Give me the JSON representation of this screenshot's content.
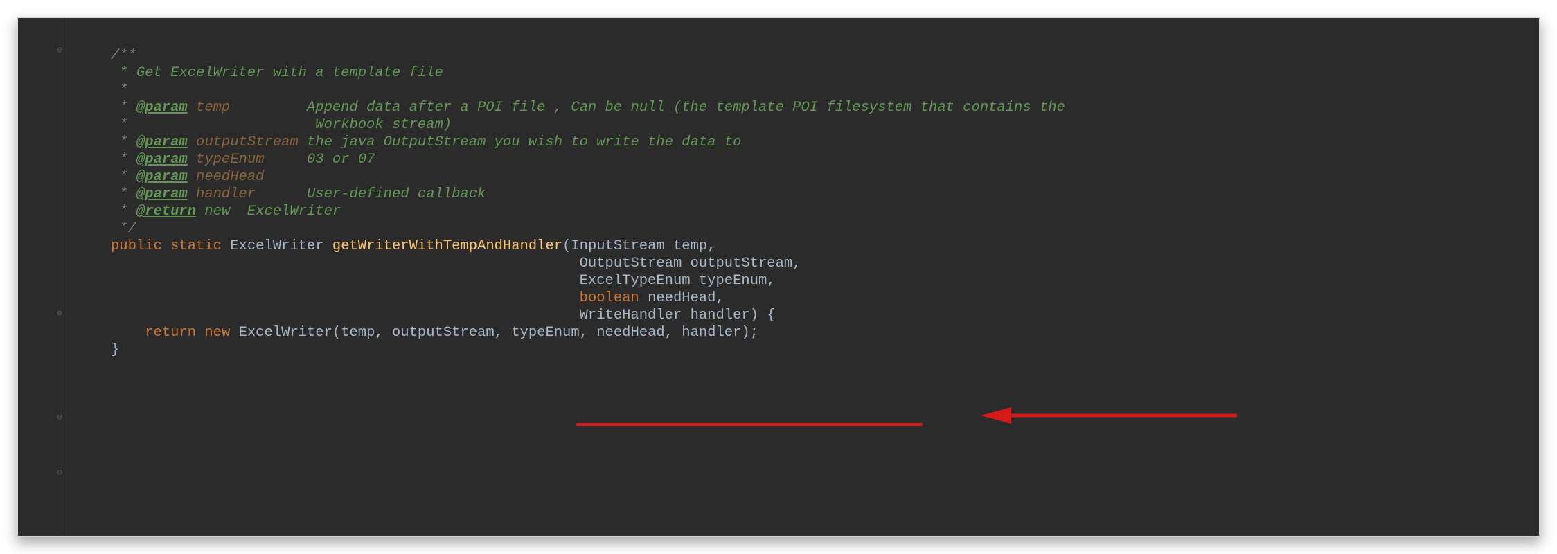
{
  "javadoc": {
    "open": "/**",
    "summary": " * Get ExcelWriter with a template file",
    "blank": " *",
    "params": [
      {
        "tag": "@param",
        "name": "temp",
        "desc1": "Append data after a POI file , Can be null (the template POI filesystem that contains the",
        "desc2": "Workbook stream)"
      },
      {
        "tag": "@param",
        "name": "outputStream",
        "desc1": "the java OutputStream you wish to write the data to"
      },
      {
        "tag": "@param",
        "name": "typeEnum",
        "desc1": "03 or 07"
      },
      {
        "tag": "@param",
        "name": "needHead",
        "desc1": ""
      },
      {
        "tag": "@param",
        "name": "handler",
        "desc1": "User-defined callback"
      }
    ],
    "ret": {
      "tag": "@return",
      "desc": "new  ExcelWriter"
    },
    "close": " */"
  },
  "method": {
    "mod_public": "public",
    "mod_static": "static",
    "ret_type": "ExcelWriter",
    "name": "getWriterWithTempAndHandler",
    "params": [
      {
        "type": "InputStream",
        "name": "temp"
      },
      {
        "type": "OutputStream",
        "name": "outputStream"
      },
      {
        "type": "ExcelTypeEnum",
        "name": "typeEnum"
      },
      {
        "type": "boolean",
        "name": "needHead",
        "keyword": true
      },
      {
        "type": "WriteHandler",
        "name": "handler"
      }
    ],
    "body": {
      "ret": "return",
      "new": "new",
      "ctor": "ExcelWriter",
      "args": "(temp, outputStream, typeEnum, needHead, handler);"
    },
    "close": "}"
  },
  "annotation": {
    "underline_target": "WriteHandler handler",
    "arrow_color": "#d61a1a"
  }
}
